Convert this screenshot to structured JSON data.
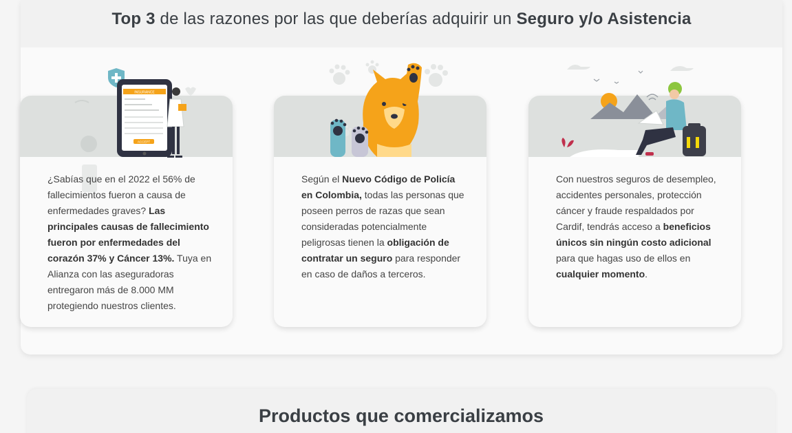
{
  "headline": {
    "part1": "Top 3",
    "part2": " de las razones por las que deberías adquirir un ",
    "part3": "Seguro y/o Asistencia"
  },
  "cards": [
    {
      "illustration": "phone-insurance-doctor-illustration",
      "phone_header": "INSURANCE",
      "phone_button": "ACCEPT",
      "text": {
        "t1": "¿Sabías que en el 2022 el 56% de fallecimientos fueron a causa de enfermedades graves? ",
        "b1": "Las principales causas de fallecimiento fueron por enfermedades del corazón 37% y Cáncer 13%.",
        "t2": " Tuya en Alianza con las aseguradoras entregaron más de 8.000 MM protegiendo nuestros clientes."
      }
    },
    {
      "illustration": "dog-paws-illustration",
      "text": {
        "t1": "Según el ",
        "b1": "Nuevo Código de Policía en Colombia,",
        "t2": " todas las personas que poseen perros de razas que sean consideradas potencialmente peligrosas tienen la ",
        "b2": "obligación de contratar un seguro",
        "t3": " para responder en caso de daños a terceros."
      }
    },
    {
      "illustration": "person-laptop-mountains-illustration",
      "text": {
        "t1": "Con nuestros seguros de desempleo, accidentes personales, protección cáncer y fraude respaldados por Cardif, tendrás acceso a ",
        "b1": "beneficios únicos sin ningún costo adicional",
        "t2": " para que hagas uso de ellos en ",
        "b2": "cualquier momento",
        "t3": "."
      }
    }
  ],
  "products": {
    "title": "Productos que comercializamos"
  },
  "colors": {
    "accent_orange": "#f5a31a",
    "teal": "#6fb7c6",
    "band_gray": "#dde0de",
    "dark_navy": "#2f3242"
  }
}
